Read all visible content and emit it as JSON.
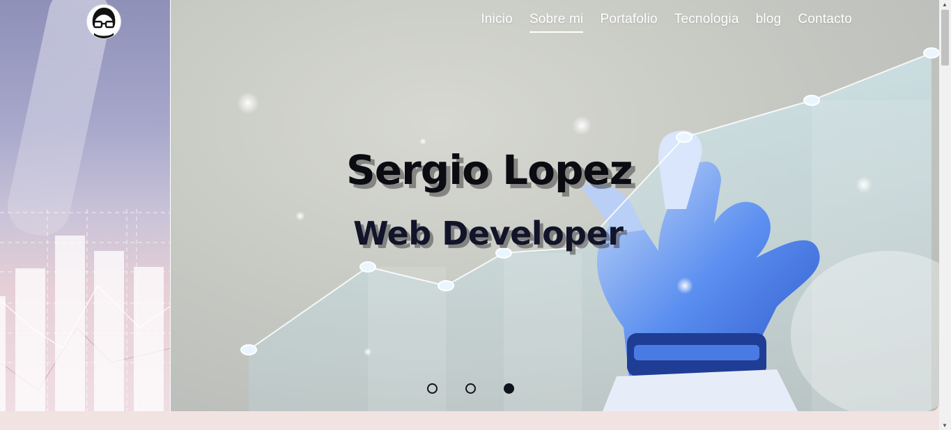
{
  "nav": {
    "items": [
      {
        "label": "Inicio",
        "active": false
      },
      {
        "label": "Sobre mi",
        "active": true
      },
      {
        "label": "Portafolio",
        "active": false
      },
      {
        "label": "Tecnologia",
        "active": false
      },
      {
        "label": "blog",
        "active": false
      },
      {
        "label": "Contacto",
        "active": false
      }
    ]
  },
  "hero": {
    "title": "Sergio Lopez",
    "subtitle": "Web Developer",
    "carousel": {
      "slide_count": 3,
      "active_index": 2
    }
  },
  "avatar": {
    "icon": "glasses-avatar-icon"
  },
  "colors": {
    "nav_text": "#ffffff",
    "title_text": "#0b0b12",
    "dot_color": "#11131c",
    "page_background": "#f1e3e2"
  }
}
